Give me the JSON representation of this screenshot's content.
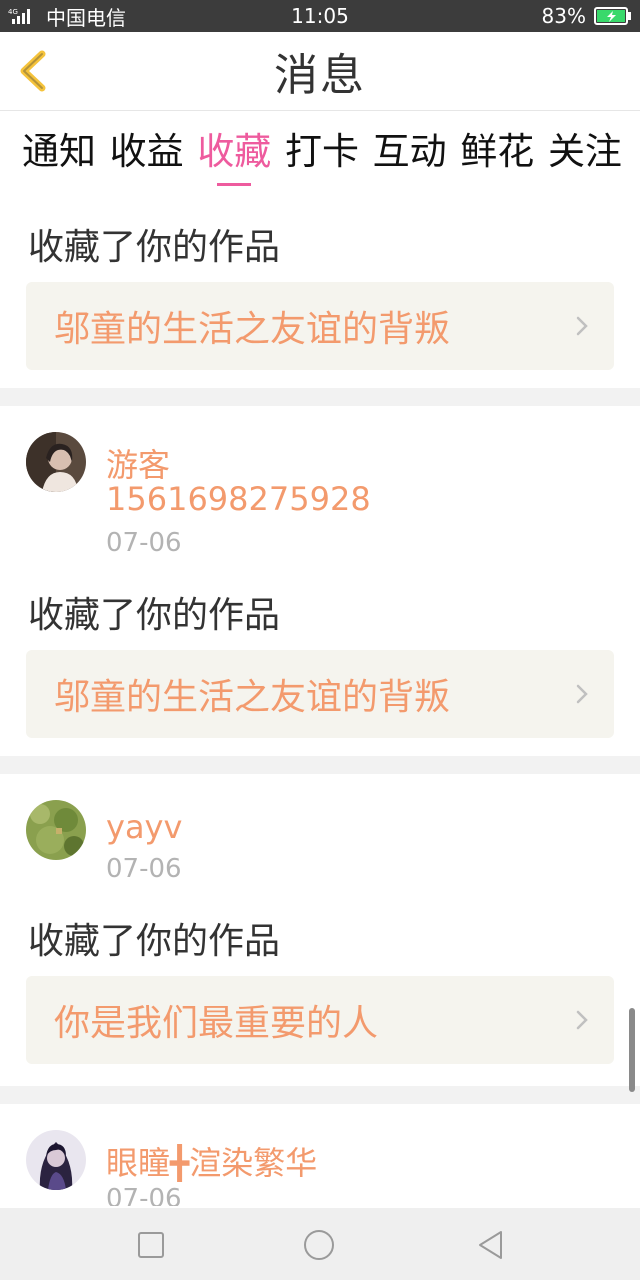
{
  "status_bar": {
    "network": "4G",
    "carrier": "中国电信",
    "time": "11:05",
    "battery": "83%",
    "battery_color": "#39d96b"
  },
  "header": {
    "title": "消息",
    "back_icon": "chevron-left-icon",
    "accent_color": "#f5c33b"
  },
  "tabs": [
    {
      "label": "通知",
      "active": false
    },
    {
      "label": "收益",
      "active": false
    },
    {
      "label": "收藏",
      "active": true
    },
    {
      "label": "打卡",
      "active": false
    },
    {
      "label": "互动",
      "active": false
    },
    {
      "label": "鲜花",
      "active": false
    },
    {
      "label": "关注",
      "active": false
    }
  ],
  "active_tab_color": "#ee5b9e",
  "notifications": [
    {
      "user_name": "",
      "user_name_line2": "",
      "date": "",
      "action": "收藏了你的作品",
      "work_title": "邬童的生活之友谊的背叛"
    },
    {
      "user_name": "游客",
      "user_name_line2": "1561698275928",
      "date": "07-06",
      "action": "收藏了你的作品",
      "work_title": "邬童的生活之友谊的背叛"
    },
    {
      "user_name": "yayv",
      "date": "07-06",
      "action": "收藏了你的作品",
      "work_title": "你是我们最重要的人"
    },
    {
      "user_name": "眼瞳╋渲染繁华",
      "date": "07-06"
    }
  ],
  "colors": {
    "name_color": "#f39a6d",
    "card_bg": "#f5f4ee",
    "date_color": "#b3b3b3"
  },
  "nav_bar": {
    "buttons": [
      "recent-apps-icon",
      "home-icon",
      "back-icon"
    ]
  }
}
